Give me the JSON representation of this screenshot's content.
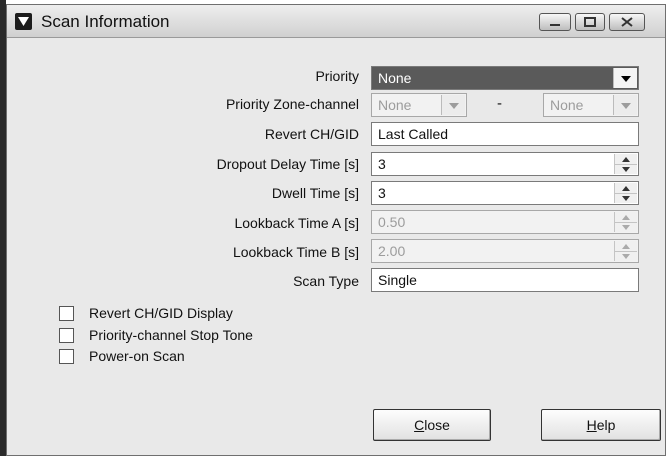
{
  "window": {
    "title": "Scan Information"
  },
  "fields": {
    "priority": {
      "label": "Priority",
      "value": "None"
    },
    "zone": {
      "label": "Priority Zone-channel",
      "left": "None",
      "separator": "-",
      "right": "None"
    },
    "revert": {
      "label": "Revert CH/GID",
      "value": "Last Called"
    },
    "dropout": {
      "label": "Dropout Delay Time [s]",
      "value": "3"
    },
    "dwell": {
      "label": "Dwell Time [s]",
      "value": "3"
    },
    "lookback_a": {
      "label": "Lookback Time A [s]",
      "value": "0.50"
    },
    "lookback_b": {
      "label": "Lookback Time B [s]",
      "value": "2.00"
    },
    "scan_type": {
      "label": "Scan Type",
      "value": "Single"
    }
  },
  "checkboxes": [
    {
      "label": "Revert CH/GID Display",
      "checked": false
    },
    {
      "label": "Priority-channel Stop Tone",
      "checked": false
    },
    {
      "label": "Power-on Scan",
      "checked": false
    }
  ],
  "buttons": {
    "close": {
      "mnemonic": "C",
      "rest": "lose"
    },
    "help": {
      "mnemonic": "H",
      "rest": "elp"
    }
  }
}
